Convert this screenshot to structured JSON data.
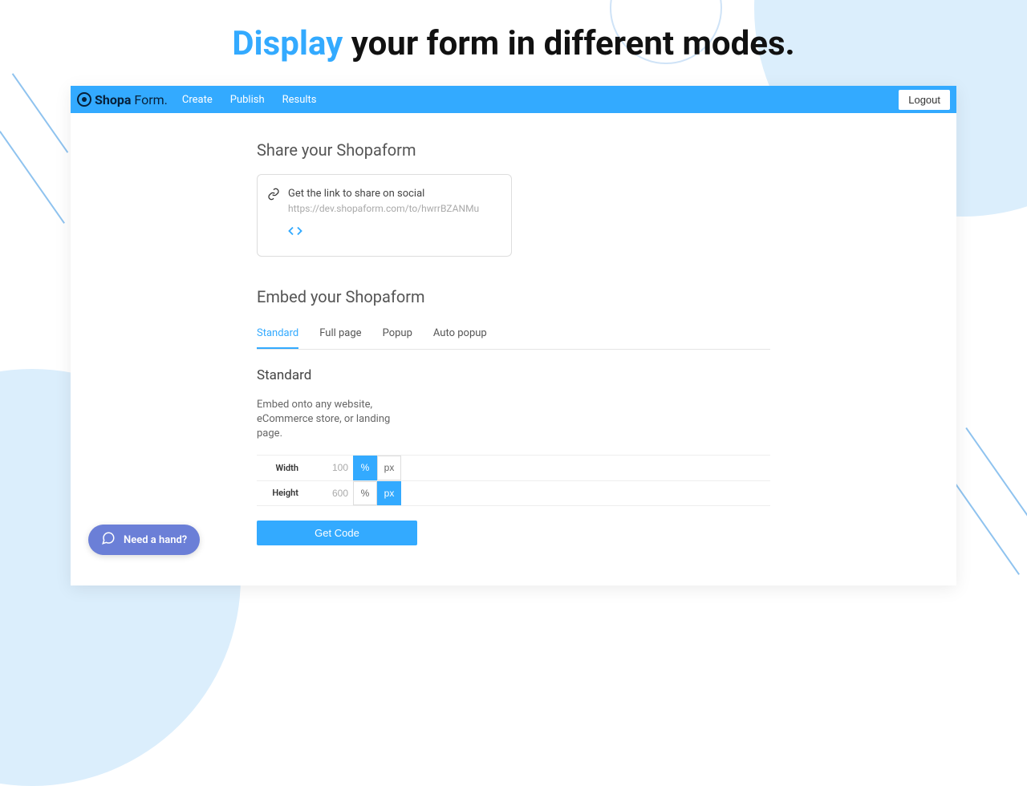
{
  "headline": {
    "accent": "Display",
    "rest": " your form in different modes."
  },
  "brand": {
    "name_bold": "Shopa",
    "name_thin": "Form."
  },
  "nav": {
    "create": "Create",
    "publish": "Publish",
    "results": "Results"
  },
  "logout": "Logout",
  "share": {
    "title": "Share your Shopaform",
    "instruction": "Get the link to share on social",
    "url": "https://dev.shopaform.com/to/hwrrBZANMu"
  },
  "embed": {
    "title": "Embed your Shopaform",
    "tabs": {
      "standard": "Standard",
      "fullpage": "Full page",
      "popup": "Popup",
      "autopopup": "Auto popup"
    },
    "subtitle": "Standard",
    "description": "Embed onto any website, eCommerce store, or landing page.",
    "width_label": "Width",
    "width_value": "100",
    "height_label": "Height",
    "height_value": "600",
    "unit_percent": "%",
    "unit_px": "px",
    "getcode": "Get Code"
  },
  "help": {
    "label": "Need a hand?"
  }
}
